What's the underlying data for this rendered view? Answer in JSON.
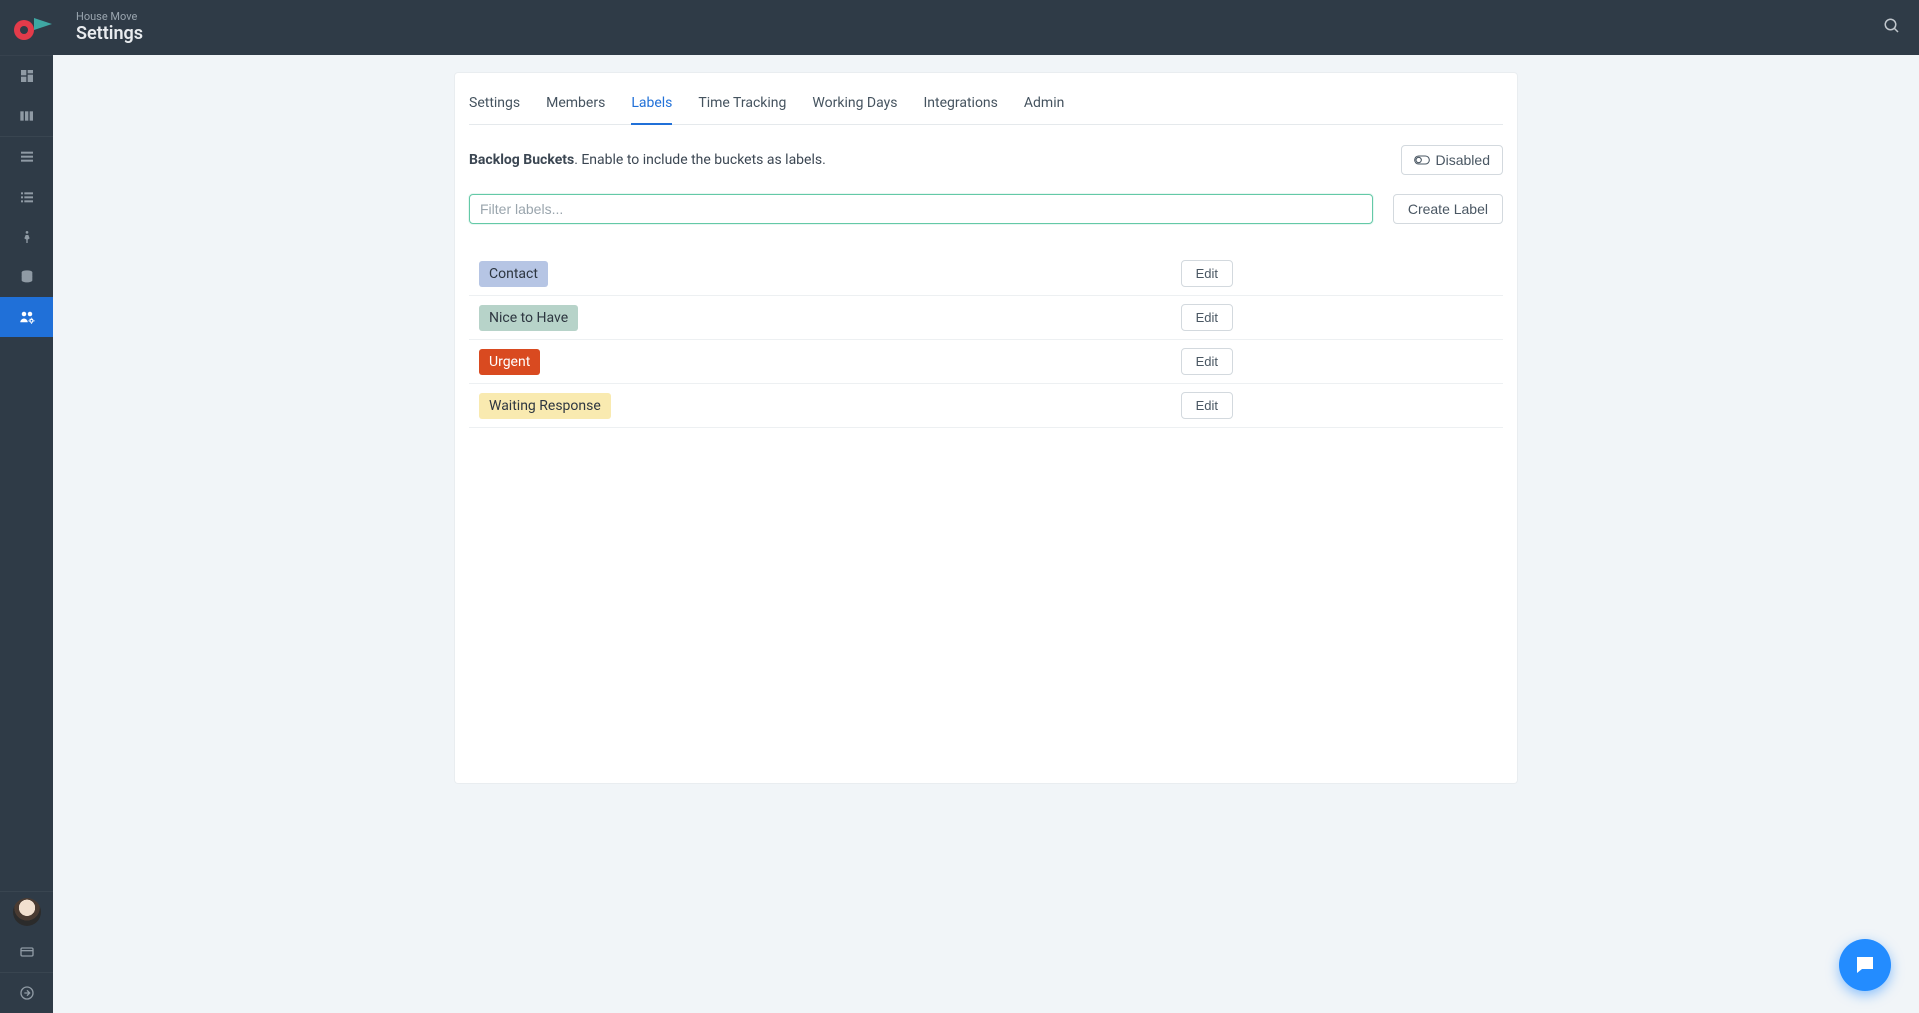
{
  "project_name": "House Move",
  "page_title": "Settings",
  "tabs": [
    {
      "label": "Settings",
      "active": false
    },
    {
      "label": "Members",
      "active": false
    },
    {
      "label": "Labels",
      "active": true
    },
    {
      "label": "Time Tracking",
      "active": false
    },
    {
      "label": "Working Days",
      "active": false
    },
    {
      "label": "Integrations",
      "active": false
    },
    {
      "label": "Admin",
      "active": false
    }
  ],
  "bucket": {
    "heading": "Backlog Buckets",
    "desc": ". Enable to include the buckets as labels.",
    "toggle_label": "Disabled"
  },
  "filter_placeholder": "Filter labels...",
  "create_label_btn": "Create Label",
  "edit_btn": "Edit",
  "labels": [
    {
      "name": "Contact",
      "bg": "#b6c5e4",
      "fg": "#2d3640"
    },
    {
      "name": "Nice to Have",
      "bg": "#b7d3c9",
      "fg": "#2d3640"
    },
    {
      "name": "Urgent",
      "bg": "#d94a20",
      "fg": "#ffffff"
    },
    {
      "name": "Waiting Response",
      "bg": "#f9eab0",
      "fg": "#2d3640"
    }
  ]
}
